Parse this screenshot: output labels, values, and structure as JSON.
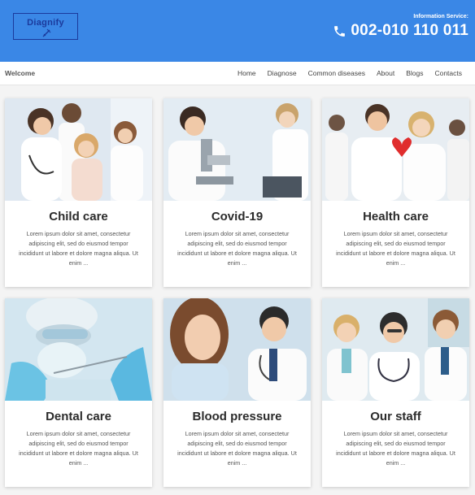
{
  "header": {
    "logo_text": "Diagnify",
    "info_label": "Information Service:",
    "phone": "002-010 110 011",
    "bg_color": "#3a87e6"
  },
  "nav": {
    "welcome": "Welcome",
    "items": [
      "Home",
      "Diagnose",
      "Common diseases",
      "About",
      "Blogs",
      "Contacts"
    ]
  },
  "cards": [
    {
      "title": "Child care",
      "text": "Lorem ipsum dolor sit amet, consectetur adipiscing elit, sed do eiusmod tempor incididunt ut labore et dolore magna aliqua. Ut enim ..."
    },
    {
      "title": "Covid-19",
      "text": "Lorem ipsum dolor sit amet, consectetur adipiscing elit, sed do eiusmod tempor incididunt ut labore et dolore magna aliqua. Ut enim ..."
    },
    {
      "title": "Health care",
      "text": "Lorem ipsum dolor sit amet, consectetur adipiscing elit, sed do eiusmod tempor incididunt ut labore et dolore magna aliqua. Ut enim ..."
    },
    {
      "title": "Dental care",
      "text": "Lorem ipsum dolor sit amet, consectetur adipiscing elit, sed do eiusmod tempor incididunt ut labore et dolore magna aliqua. Ut enim ..."
    },
    {
      "title": "Blood pressure",
      "text": "Lorem ipsum dolor sit amet, consectetur adipiscing elit, sed do eiusmod tempor incididunt ut labore et dolore magna aliqua. Ut enim ..."
    },
    {
      "title": "Our staff",
      "text": "Lorem ipsum dolor sit amet, consectetur adipiscing elit, sed do eiusmod tempor incididunt ut labore et dolore magna aliqua. Ut enim ..."
    }
  ]
}
